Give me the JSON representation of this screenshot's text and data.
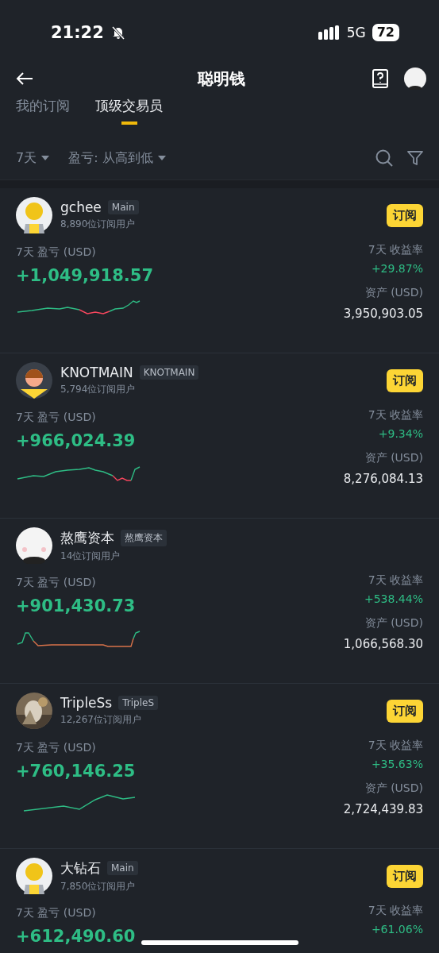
{
  "status_bar": {
    "time": "21:22",
    "network": "5G",
    "battery": "72"
  },
  "header": {
    "title": "聪明钱"
  },
  "tabs": [
    {
      "label": "我的订阅",
      "selected": false
    },
    {
      "label": "顶级交易员",
      "selected": true
    }
  ],
  "filters": [
    {
      "label": "7天"
    },
    {
      "label": "盈亏: 从高到低"
    }
  ],
  "traders": [
    {
      "name": "gchee",
      "tag": "Main",
      "subscribers": "8,890位订阅用户",
      "avatar": {
        "kind": "default"
      },
      "subscribe": "订阅",
      "pnl_label": "7天 盈亏 (USD)",
      "pnl": "+1,049,918.57",
      "roi_label": "7天 收益率",
      "roi": "+29.87%",
      "assets_label": "资产 (USD)",
      "assets": "3,950,903.05"
    },
    {
      "name": "KNOTMAIN",
      "tag": "KNOTMAIN",
      "subscribers": "5,794位订阅用户",
      "avatar": {
        "kind": "person"
      },
      "subscribe": "订阅",
      "pnl_label": "7天 盈亏 (USD)",
      "pnl": "+966,024.39",
      "roi_label": "7天 收益率",
      "roi": "+9.34%",
      "assets_label": "资产 (USD)",
      "assets": "8,276,084.13"
    },
    {
      "name": "熬鹰资本",
      "tag": "熬鹰资本",
      "subscribers": "14位订阅用户",
      "avatar": {
        "kind": "cartoon"
      },
      "pnl_label": "7天 盈亏 (USD)",
      "pnl": "+901,430.73",
      "roi_label": "7天 收益率",
      "roi": "+538.44%",
      "assets_label": "资产 (USD)",
      "assets": "1,066,568.30"
    },
    {
      "name": "TripleSs",
      "tag": "TripleS",
      "subscribers": "12,267位订阅用户",
      "subscribe": "订阅",
      "pnl_label": "7天 盈亏 (USD)",
      "pnl": "+760,146.25",
      "roi_label": "7天 收益率",
      "roi": "+35.63%",
      "assets_label": "资产 (USD)",
      "assets": "2,724,439.83"
    },
    {
      "name": "大钻石",
      "tag": "Main",
      "subscribers": "7,850位订阅用户",
      "avatar": {
        "kind": "default"
      },
      "subscribe": "订阅",
      "pnl_label": "7天 盈亏 (USD)",
      "pnl": "+612,490.60",
      "roi_label": "7天 收益率",
      "roi": "+61.06%"
    }
  ]
}
